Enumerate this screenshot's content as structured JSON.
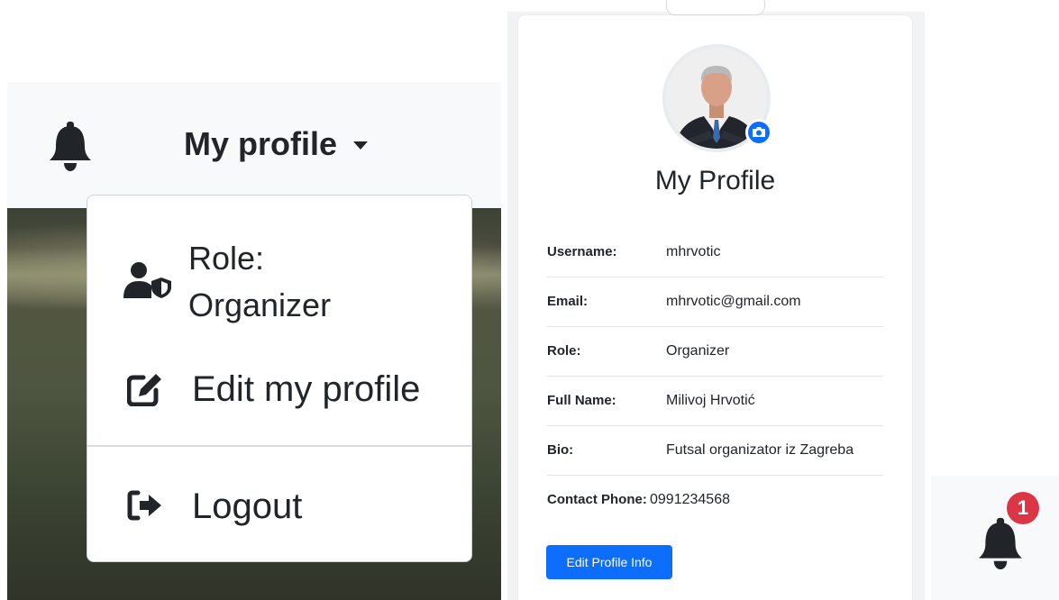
{
  "navbar": {
    "profile_label": "My profile",
    "bell_icon": "bell-icon",
    "caret_icon": "caret-down-icon"
  },
  "dropdown": {
    "role_line1": "Role:",
    "role_line2": "Organizer",
    "role_icon": "user-shield-icon",
    "edit_label": "Edit my profile",
    "edit_icon": "pen-to-square-icon",
    "logout_label": "Logout",
    "logout_icon": "right-from-bracket-icon"
  },
  "profile_card": {
    "title": "My Profile",
    "avatar_icon": "avatar-photo",
    "camera_icon": "camera-icon",
    "fields": [
      {
        "label": "Username:",
        "value": "mhrvotic"
      },
      {
        "label": "Email:",
        "value": "mhrvotic@gmail.com"
      },
      {
        "label": "Role:",
        "value": "Organizer"
      },
      {
        "label": "Full Name:",
        "value": "Milivoj Hrvotić"
      },
      {
        "label": "Bio:",
        "value": "Futsal organizator iz Zagreba"
      },
      {
        "label": "Contact Phone:",
        "value": "0991234568"
      }
    ],
    "edit_button_label": "Edit Profile Info"
  },
  "notification": {
    "count": "1",
    "bell_icon": "bell-icon"
  },
  "colors": {
    "primary": "#0d6efd",
    "danger": "#dc3545",
    "text": "#212529",
    "navbar_bg": "#f8f9fa"
  }
}
